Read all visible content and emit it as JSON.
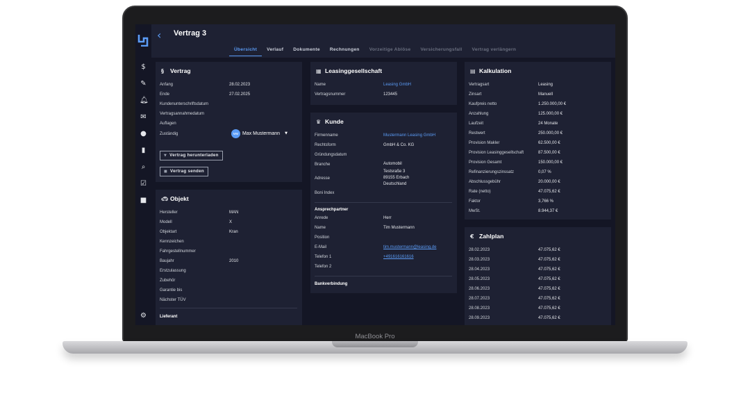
{
  "device": {
    "brand": "MacBook Pro"
  },
  "header": {
    "title": "Vertrag 3",
    "tabs": [
      {
        "label": "Übersicht",
        "state": "active"
      },
      {
        "label": "Verlauf",
        "state": "normal"
      },
      {
        "label": "Dokumente",
        "state": "normal"
      },
      {
        "label": "Rechnungen",
        "state": "normal"
      },
      {
        "label": "Vorzeitige Ablöse",
        "state": "disabled"
      },
      {
        "label": "Versicherungsfall",
        "state": "disabled"
      },
      {
        "label": "Vertrag verlängern",
        "state": "disabled"
      }
    ]
  },
  "sidebar": {
    "icons": [
      "dollar-icon",
      "edit-document-icon",
      "bell-icon",
      "mail-icon",
      "users-icon",
      "chart-icon",
      "search-icon",
      "checkbox-icon",
      "grid-icon",
      "gear-icon"
    ]
  },
  "vertrag": {
    "title": "Vertrag",
    "rows": [
      {
        "label": "Anfang",
        "value": "28.02.2023"
      },
      {
        "label": "Ende",
        "value": "27.02.2025"
      },
      {
        "label": "Kundenunterschriftsdatum",
        "value": ""
      },
      {
        "label": "Vertragsannahmedatum",
        "value": ""
      },
      {
        "label": "Auflagen",
        "value": ""
      }
    ],
    "zustaendig_label": "Zuständig",
    "user": {
      "initials": "MM",
      "name": "Max Mustermann"
    },
    "download_button": "Vertrag herunterladen",
    "send_button": "Vertrag senden"
  },
  "objekt": {
    "title": "Objekt",
    "rows": [
      {
        "label": "Hersteller",
        "value": "MAN"
      },
      {
        "label": "Modell",
        "value": "X"
      },
      {
        "label": "Objektart",
        "value": "Kran"
      },
      {
        "label": "Kennzeichen",
        "value": ""
      },
      {
        "label": "Fahrgestellnummer",
        "value": ""
      },
      {
        "label": "Baujahr",
        "value": "2010"
      },
      {
        "label": "Erstzulassung",
        "value": ""
      },
      {
        "label": "Zubehör",
        "value": ""
      },
      {
        "label": "Garantie bis",
        "value": ""
      },
      {
        "label": "Nächster TÜV",
        "value": ""
      }
    ],
    "lieferant": "Lieferant"
  },
  "leasinggesellschaft": {
    "title": "Leasinggesellschaft",
    "rows": [
      {
        "label": "Name",
        "value": "Leasing GmbH"
      },
      {
        "label": "Vertragsnummer",
        "value": "123445"
      }
    ]
  },
  "kunde": {
    "title": "Kunde",
    "firmenname_label": "Firmenname",
    "firmenname": "Mustermann Leasing GmbH",
    "rechtsform_label": "Rechtsform",
    "rechtsform": "GmbH & Co. KG",
    "gruendung_label": "Gründungsdatum",
    "branche_label": "Branche",
    "branche": "Automobil",
    "adresse_label": "Adresse",
    "adresse_line1": "Testsraße 3",
    "adresse_line2": "89155 Erbach",
    "adresse_line3": "Deutschland",
    "boni_label": "Boni Index",
    "ansprechpartner": "Ansprechpartner",
    "anrede_label": "Anrede",
    "anrede": "Herr",
    "name_label": "Name",
    "name": "Tim Mustermann",
    "position_label": "Position",
    "email_label": "E-Mail",
    "email": "tim.mustermann@leasing.de",
    "telefon1_label": "Telefon 1",
    "telefon1": "+491616161616",
    "telefon2_label": "Telefon 2",
    "bankverbindung": "Bankverbindung"
  },
  "kalkulation": {
    "title": "Kalkulation",
    "rows": [
      {
        "label": "Vertragsart",
        "value": "Leasing"
      },
      {
        "label": "Zinsart",
        "value": "Manuell"
      },
      {
        "label": "Kaufpreis netto",
        "value": "1.250.000,00 €"
      },
      {
        "label": "Anzahlung",
        "value": "125.000,00 €"
      },
      {
        "label": "Laufzeit",
        "value": "24 Monate"
      },
      {
        "label": "Restwert",
        "value": "250.000,00 €"
      },
      {
        "label": "Provision Makler",
        "value": "62.500,00 €"
      },
      {
        "label": "Provision Leasinggesellschaft",
        "value": "87.500,00 €"
      },
      {
        "label": "Provision Gesamt",
        "value": "150.000,00 €"
      },
      {
        "label": "Refinanzierungszinssatz",
        "value": "0,07 %"
      },
      {
        "label": "Abschlussgebühr",
        "value": "20.000,00 €"
      },
      {
        "label": "Rate (netto)",
        "value": "47.075,62 €"
      },
      {
        "label": "Faktor",
        "value": "3,766 %"
      },
      {
        "label": "MwSt.",
        "value": "8.944,37 €"
      }
    ]
  },
  "zahlplan": {
    "title": "Zahlplan",
    "rows": [
      {
        "date": "28.02.2023",
        "amount": "47.075,62 €"
      },
      {
        "date": "28.03.2023",
        "amount": "47.075,62 €"
      },
      {
        "date": "28.04.2023",
        "amount": "47.075,62 €"
      },
      {
        "date": "28.05.2023",
        "amount": "47.075,62 €"
      },
      {
        "date": "28.06.2023",
        "amount": "47.075,62 €"
      },
      {
        "date": "28.07.2023",
        "amount": "47.075,62 €"
      },
      {
        "date": "28.08.2023",
        "amount": "47.075,62 €"
      },
      {
        "date": "28.09.2023",
        "amount": "47.075,62 €"
      }
    ]
  }
}
